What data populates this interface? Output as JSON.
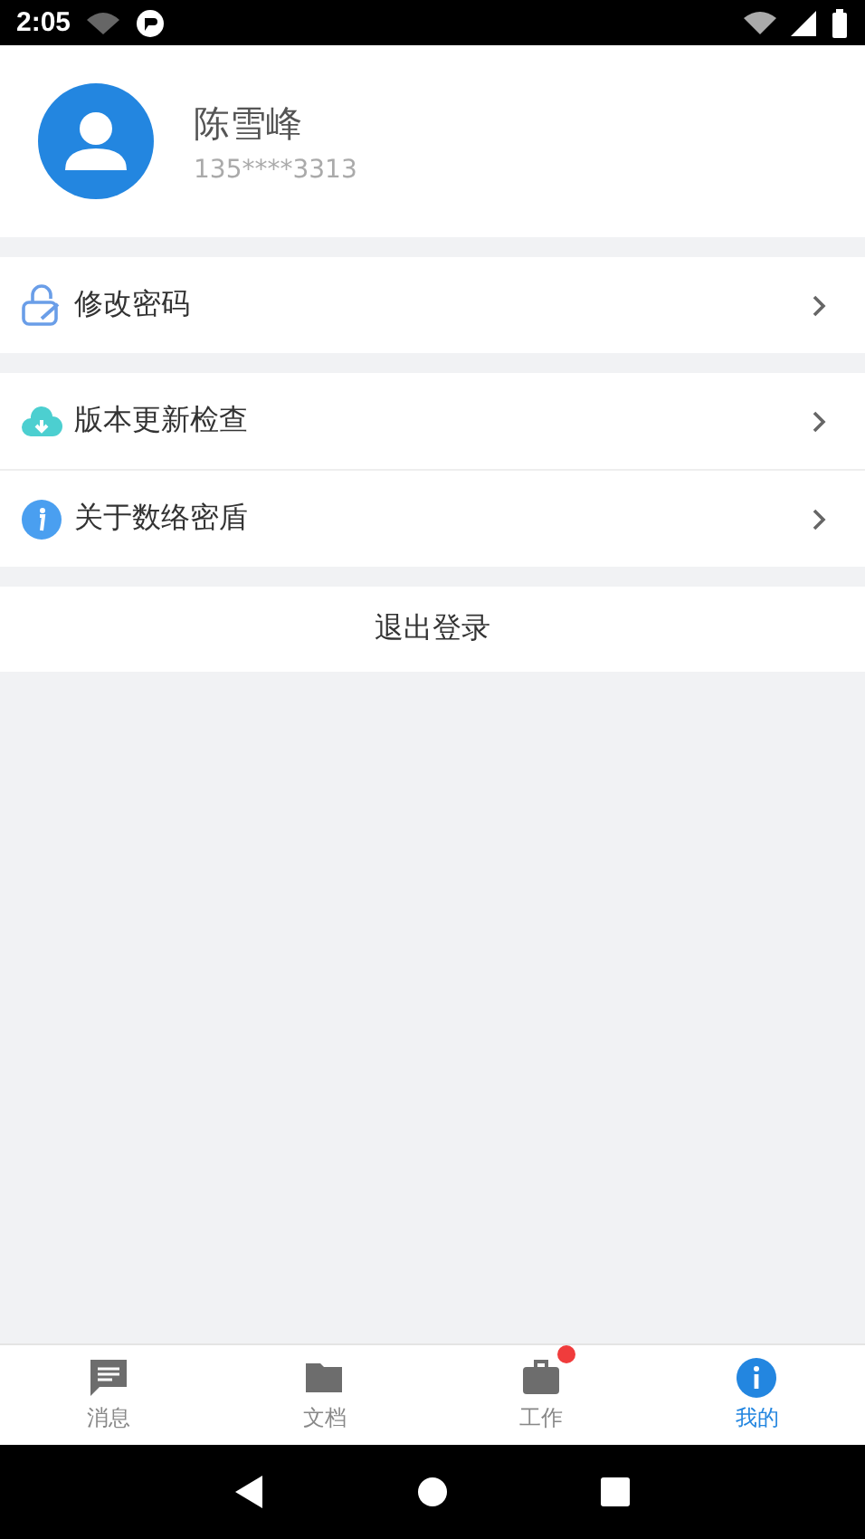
{
  "status_bar": {
    "time": "2:05"
  },
  "profile": {
    "name": "陈雪峰",
    "phone": "135****3313"
  },
  "menu_groups": [
    [
      {
        "kind": "lock",
        "label": "修改密码"
      }
    ],
    [
      {
        "kind": "cloud",
        "label": "版本更新检查"
      },
      {
        "kind": "info",
        "label": "关于数络密盾"
      }
    ]
  ],
  "logout": "退出登录",
  "tabs": [
    {
      "kind": "chat",
      "label": "消息",
      "selected": false,
      "badge": false
    },
    {
      "kind": "folder",
      "label": "文档",
      "selected": false,
      "badge": false
    },
    {
      "kind": "briefcase",
      "label": "工作",
      "selected": false,
      "badge": true
    },
    {
      "kind": "info",
      "label": "我的",
      "selected": true,
      "badge": false
    }
  ]
}
